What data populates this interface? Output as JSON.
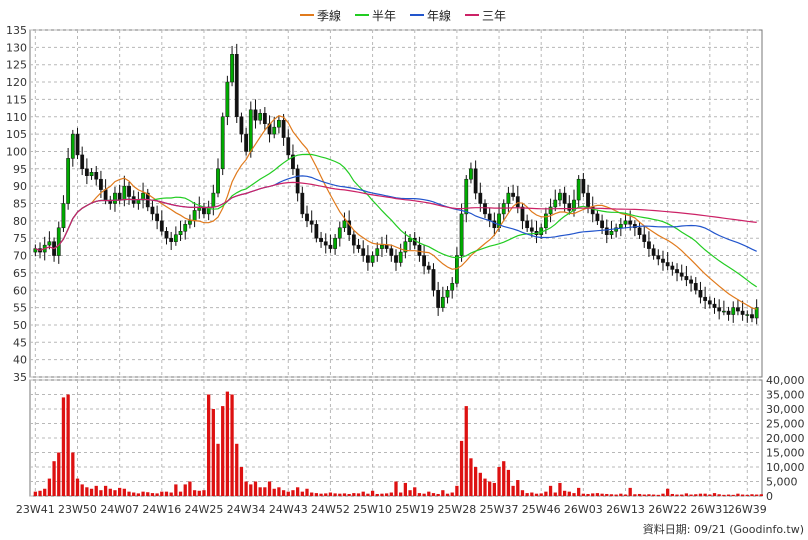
{
  "legend": [
    {
      "label": "季線",
      "color": "#e07a1c"
    },
    {
      "label": "半年",
      "color": "#22cc22"
    },
    {
      "label": "年線",
      "color": "#2255cc"
    },
    {
      "label": "三年",
      "color": "#cc2266"
    }
  ],
  "footer": "資料日期: 09/21  (Goodinfo.tw)",
  "chart_data": {
    "type": "candlestick",
    "price_axis": {
      "ticks": [
        35,
        40,
        45,
        50,
        55,
        60,
        65,
        70,
        75,
        80,
        85,
        90,
        95,
        100,
        105,
        110,
        115,
        120,
        125,
        130,
        135
      ],
      "range": [
        35,
        135
      ],
      "side": "left"
    },
    "volume_axis": {
      "ticks": [
        0,
        5000,
        10000,
        15000,
        20000,
        25000,
        30000,
        35000,
        40000
      ],
      "labels": [
        "0",
        "5,000",
        "10,000",
        "15,000",
        "20,000",
        "25,000",
        "30,000",
        "35,000",
        "40,000"
      ],
      "range": [
        0,
        40000
      ],
      "side": "right"
    },
    "x_labels": [
      "23W41",
      "23W50",
      "24W07",
      "24W16",
      "24W25",
      "24W34",
      "24W43",
      "24W52",
      "25W10",
      "25W19",
      "25W28",
      "25W37",
      "25W46",
      "26W03",
      "26W13",
      "26W22",
      "26W31",
      "26W39"
    ],
    "x_label_index": [
      0,
      9,
      18,
      27,
      36,
      45,
      54,
      63,
      72,
      81,
      90,
      99,
      108,
      117,
      126,
      135,
      144,
      152
    ],
    "grid": true,
    "colors": {
      "up": "#00aa00",
      "down": "#111111",
      "volume": "#dd1111",
      "grid": "#b8b8b8"
    },
    "closes": [
      72,
      71,
      73,
      74,
      70,
      78,
      85,
      98,
      105,
      99,
      95,
      93,
      94,
      92,
      89,
      86,
      85,
      88,
      86,
      90,
      87,
      85,
      86,
      88,
      84,
      82,
      80,
      77,
      75,
      74,
      76,
      77,
      79,
      80,
      83,
      84,
      82,
      84,
      88,
      95,
      110,
      120,
      128,
      110,
      105,
      100,
      112,
      109,
      111,
      108,
      105,
      107,
      109,
      104,
      99,
      95,
      88,
      82,
      80,
      79,
      75,
      74,
      73,
      72,
      75,
      78,
      80,
      76,
      73,
      72,
      70,
      68,
      70,
      72,
      73,
      72,
      70,
      68,
      71,
      74,
      75,
      73,
      70,
      67,
      66,
      60,
      55,
      58,
      60,
      62,
      70,
      82,
      92,
      95,
      88,
      85,
      82,
      80,
      78,
      82,
      85,
      88,
      87,
      84,
      80,
      78,
      77,
      76,
      78,
      82,
      84,
      86,
      88,
      85,
      83,
      86,
      92,
      88,
      84,
      82,
      80,
      78,
      76,
      77,
      78,
      79,
      80,
      79,
      78,
      76,
      74,
      72,
      70,
      69,
      68,
      67,
      66,
      65,
      64,
      63,
      62,
      60,
      58,
      57,
      56,
      55,
      54,
      54,
      53,
      55,
      54,
      53,
      53,
      52,
      55
    ],
    "volume": [
      1500,
      1800,
      2500,
      6000,
      12000,
      15000,
      34000,
      35000,
      15000,
      6000,
      4000,
      3000,
      2500,
      3500,
      2000,
      3500,
      2500,
      2000,
      2800,
      2500,
      1500,
      1200,
      900,
      1500,
      1300,
      1000,
      900,
      1500,
      1500,
      1200,
      4000,
      1500,
      4000,
      5000,
      2000,
      1800,
      2000,
      35000,
      30000,
      18000,
      31000,
      36000,
      35000,
      18000,
      10000,
      5000,
      4000,
      5000,
      3000,
      3000,
      5000,
      2500,
      3000,
      2000,
      1500,
      2000,
      3000,
      1500,
      2500,
      1200,
      1000,
      800,
      900,
      1200,
      900,
      800,
      900,
      700,
      1000,
      900,
      1500,
      800,
      1800,
      700,
      800,
      900,
      1200,
      5000,
      1200,
      4500,
      2000,
      3000,
      1000,
      800,
      1500,
      1000,
      700,
      2000,
      800,
      1200,
      3500,
      19000,
      31000,
      13000,
      10000,
      8000,
      6000,
      5000,
      4500,
      10000,
      12000,
      9000,
      3500,
      5500,
      2000,
      1000,
      1200,
      800,
      900,
      1500,
      3500,
      1200,
      4500,
      1800,
      1500,
      1000,
      2800,
      800,
      700,
      900,
      1000,
      800,
      700,
      600,
      500,
      800,
      500,
      2800,
      600,
      700,
      500,
      600,
      500,
      400,
      800,
      2500,
      700,
      500,
      500,
      900,
      500,
      600,
      800,
      800,
      500,
      1000,
      600,
      400,
      500,
      400,
      800,
      500,
      400,
      600,
      500,
      600
    ]
  }
}
